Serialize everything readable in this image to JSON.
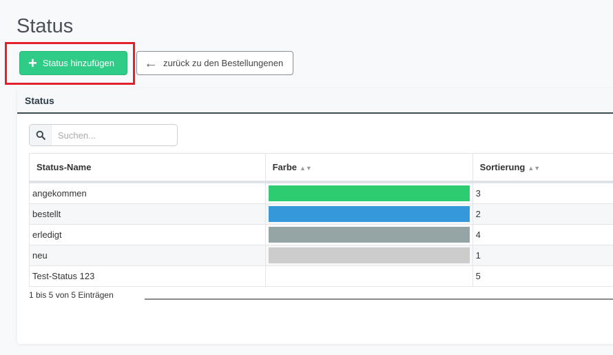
{
  "page": {
    "title": "Status"
  },
  "toolbar": {
    "add_label": "Status hinzufügen",
    "back_label": "zurück zu den Bestellungenen"
  },
  "card": {
    "title": "Status",
    "search_placeholder": "Suchen...",
    "columns": [
      "Status-Name",
      "Farbe",
      "Sortierung"
    ],
    "rows": [
      {
        "name": "angekommen",
        "color": "#2ecc71",
        "sort": "3"
      },
      {
        "name": "bestellt",
        "color": "#3498db",
        "sort": "2"
      },
      {
        "name": "erledigt",
        "color": "#95a5a6",
        "sort": "4"
      },
      {
        "name": "neu",
        "color": "#cccccc",
        "sort": "1"
      },
      {
        "name": "Test-Status 123",
        "color": "",
        "sort": "5"
      }
    ],
    "info": "1 bis 5 von 5 Einträgen"
  },
  "colors": {
    "accent_green": "#2ecc86",
    "highlight_red": "#e0202a",
    "header_border": "#3c4a54"
  },
  "icons": {
    "add": "plus-icon",
    "back": "arrow-left-icon",
    "search": "search-icon",
    "sort": "sort-icon"
  }
}
